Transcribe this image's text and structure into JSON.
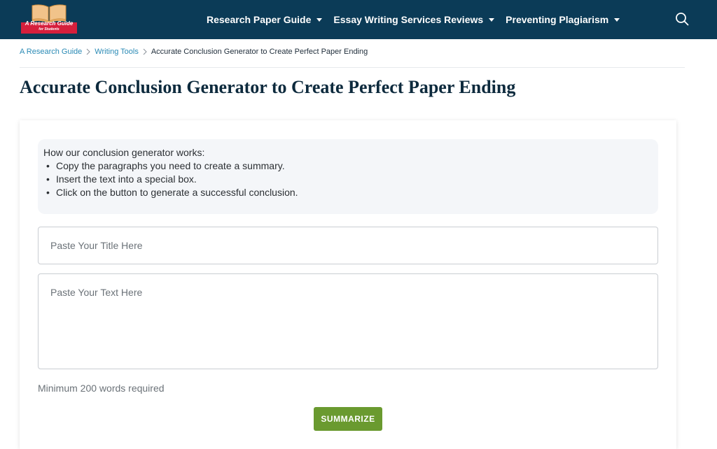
{
  "header": {
    "logo": {
      "main_text": "A Research Guide",
      "sub_text": "for Students"
    },
    "nav": [
      {
        "label": "Research Paper Guide"
      },
      {
        "label": "Essay Writing Services Reviews"
      },
      {
        "label": "Preventing Plagiarism"
      }
    ],
    "search_icon": "search-icon",
    "bg_color": "#0b3b57"
  },
  "breadcrumb": {
    "items": [
      {
        "label": "A Research Guide"
      },
      {
        "label": "Writing Tools"
      }
    ],
    "current": "Accurate Conclusion Generator to Create Perfect Paper Ending"
  },
  "page": {
    "title": "Accurate Conclusion Generator to Create Perfect Paper Ending"
  },
  "tool": {
    "howto_heading": "How our conclusion generator works:",
    "steps": [
      "Copy the paragraphs you need to create a summary.",
      "Insert the text into a special box.",
      "Click on the button to generate a successful conclusion."
    ],
    "title_placeholder": "Paste Your Title Here",
    "text_placeholder": "Paste Your Text Here",
    "min_note": "Minimum 200 words required",
    "button_label": "SUMMARIZE",
    "button_color": "#6a9a2f"
  }
}
